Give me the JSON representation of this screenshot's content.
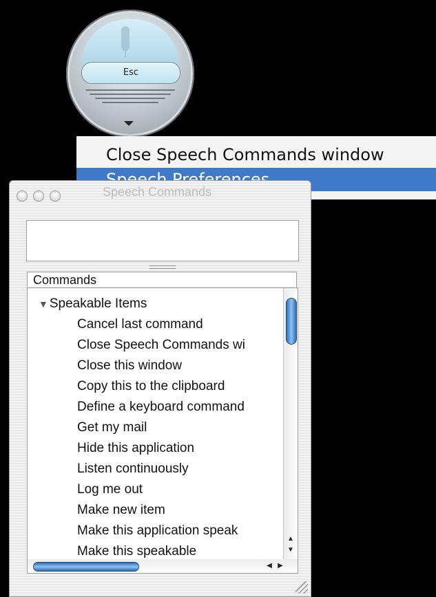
{
  "feedback": {
    "esc_label": "Esc",
    "mic_icon": "microphone-icon",
    "menu_icon": "triangle-down-icon"
  },
  "menu": {
    "items": [
      {
        "label": "Close Speech Commands window",
        "selected": false
      },
      {
        "label": "Speech Preferences...",
        "selected": true
      }
    ],
    "accent_color": "#3f79c9"
  },
  "window": {
    "title": "Speech Commands",
    "commands_header": "Commands",
    "group_label": "Speakable Items",
    "items": [
      "Cancel last command",
      "Close Speech Commands wi",
      "Close this window",
      "Copy this to the clipboard",
      "Define a keyboard command",
      "Get my mail",
      "Hide this application",
      "Listen continuously",
      "Log me out",
      "Make new item",
      "Make this application speak",
      "Make this speakable"
    ]
  }
}
